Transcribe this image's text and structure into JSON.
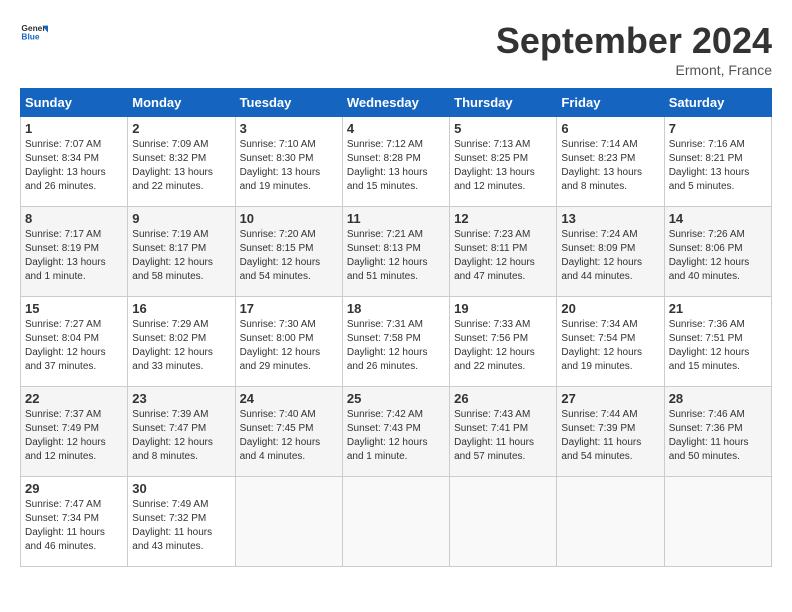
{
  "header": {
    "logo_general": "General",
    "logo_blue": "Blue",
    "month": "September 2024",
    "location": "Ermont, France"
  },
  "columns": [
    "Sunday",
    "Monday",
    "Tuesday",
    "Wednesday",
    "Thursday",
    "Friday",
    "Saturday"
  ],
  "weeks": [
    [
      {
        "day": "1",
        "rise": "Sunrise: 7:07 AM",
        "set": "Sunset: 8:34 PM",
        "light": "Daylight: 13 hours and 26 minutes."
      },
      {
        "day": "2",
        "rise": "Sunrise: 7:09 AM",
        "set": "Sunset: 8:32 PM",
        "light": "Daylight: 13 hours and 22 minutes."
      },
      {
        "day": "3",
        "rise": "Sunrise: 7:10 AM",
        "set": "Sunset: 8:30 PM",
        "light": "Daylight: 13 hours and 19 minutes."
      },
      {
        "day": "4",
        "rise": "Sunrise: 7:12 AM",
        "set": "Sunset: 8:28 PM",
        "light": "Daylight: 13 hours and 15 minutes."
      },
      {
        "day": "5",
        "rise": "Sunrise: 7:13 AM",
        "set": "Sunset: 8:25 PM",
        "light": "Daylight: 13 hours and 12 minutes."
      },
      {
        "day": "6",
        "rise": "Sunrise: 7:14 AM",
        "set": "Sunset: 8:23 PM",
        "light": "Daylight: 13 hours and 8 minutes."
      },
      {
        "day": "7",
        "rise": "Sunrise: 7:16 AM",
        "set": "Sunset: 8:21 PM",
        "light": "Daylight: 13 hours and 5 minutes."
      }
    ],
    [
      {
        "day": "8",
        "rise": "Sunrise: 7:17 AM",
        "set": "Sunset: 8:19 PM",
        "light": "Daylight: 13 hours and 1 minute."
      },
      {
        "day": "9",
        "rise": "Sunrise: 7:19 AM",
        "set": "Sunset: 8:17 PM",
        "light": "Daylight: 12 hours and 58 minutes."
      },
      {
        "day": "10",
        "rise": "Sunrise: 7:20 AM",
        "set": "Sunset: 8:15 PM",
        "light": "Daylight: 12 hours and 54 minutes."
      },
      {
        "day": "11",
        "rise": "Sunrise: 7:21 AM",
        "set": "Sunset: 8:13 PM",
        "light": "Daylight: 12 hours and 51 minutes."
      },
      {
        "day": "12",
        "rise": "Sunrise: 7:23 AM",
        "set": "Sunset: 8:11 PM",
        "light": "Daylight: 12 hours and 47 minutes."
      },
      {
        "day": "13",
        "rise": "Sunrise: 7:24 AM",
        "set": "Sunset: 8:09 PM",
        "light": "Daylight: 12 hours and 44 minutes."
      },
      {
        "day": "14",
        "rise": "Sunrise: 7:26 AM",
        "set": "Sunset: 8:06 PM",
        "light": "Daylight: 12 hours and 40 minutes."
      }
    ],
    [
      {
        "day": "15",
        "rise": "Sunrise: 7:27 AM",
        "set": "Sunset: 8:04 PM",
        "light": "Daylight: 12 hours and 37 minutes."
      },
      {
        "day": "16",
        "rise": "Sunrise: 7:29 AM",
        "set": "Sunset: 8:02 PM",
        "light": "Daylight: 12 hours and 33 minutes."
      },
      {
        "day": "17",
        "rise": "Sunrise: 7:30 AM",
        "set": "Sunset: 8:00 PM",
        "light": "Daylight: 12 hours and 29 minutes."
      },
      {
        "day": "18",
        "rise": "Sunrise: 7:31 AM",
        "set": "Sunset: 7:58 PM",
        "light": "Daylight: 12 hours and 26 minutes."
      },
      {
        "day": "19",
        "rise": "Sunrise: 7:33 AM",
        "set": "Sunset: 7:56 PM",
        "light": "Daylight: 12 hours and 22 minutes."
      },
      {
        "day": "20",
        "rise": "Sunrise: 7:34 AM",
        "set": "Sunset: 7:54 PM",
        "light": "Daylight: 12 hours and 19 minutes."
      },
      {
        "day": "21",
        "rise": "Sunrise: 7:36 AM",
        "set": "Sunset: 7:51 PM",
        "light": "Daylight: 12 hours and 15 minutes."
      }
    ],
    [
      {
        "day": "22",
        "rise": "Sunrise: 7:37 AM",
        "set": "Sunset: 7:49 PM",
        "light": "Daylight: 12 hours and 12 minutes."
      },
      {
        "day": "23",
        "rise": "Sunrise: 7:39 AM",
        "set": "Sunset: 7:47 PM",
        "light": "Daylight: 12 hours and 8 minutes."
      },
      {
        "day": "24",
        "rise": "Sunrise: 7:40 AM",
        "set": "Sunset: 7:45 PM",
        "light": "Daylight: 12 hours and 4 minutes."
      },
      {
        "day": "25",
        "rise": "Sunrise: 7:42 AM",
        "set": "Sunset: 7:43 PM",
        "light": "Daylight: 12 hours and 1 minute."
      },
      {
        "day": "26",
        "rise": "Sunrise: 7:43 AM",
        "set": "Sunset: 7:41 PM",
        "light": "Daylight: 11 hours and 57 minutes."
      },
      {
        "day": "27",
        "rise": "Sunrise: 7:44 AM",
        "set": "Sunset: 7:39 PM",
        "light": "Daylight: 11 hours and 54 minutes."
      },
      {
        "day": "28",
        "rise": "Sunrise: 7:46 AM",
        "set": "Sunset: 7:36 PM",
        "light": "Daylight: 11 hours and 50 minutes."
      }
    ],
    [
      {
        "day": "29",
        "rise": "Sunrise: 7:47 AM",
        "set": "Sunset: 7:34 PM",
        "light": "Daylight: 11 hours and 46 minutes."
      },
      {
        "day": "30",
        "rise": "Sunrise: 7:49 AM",
        "set": "Sunset: 7:32 PM",
        "light": "Daylight: 11 hours and 43 minutes."
      },
      null,
      null,
      null,
      null,
      null
    ]
  ]
}
